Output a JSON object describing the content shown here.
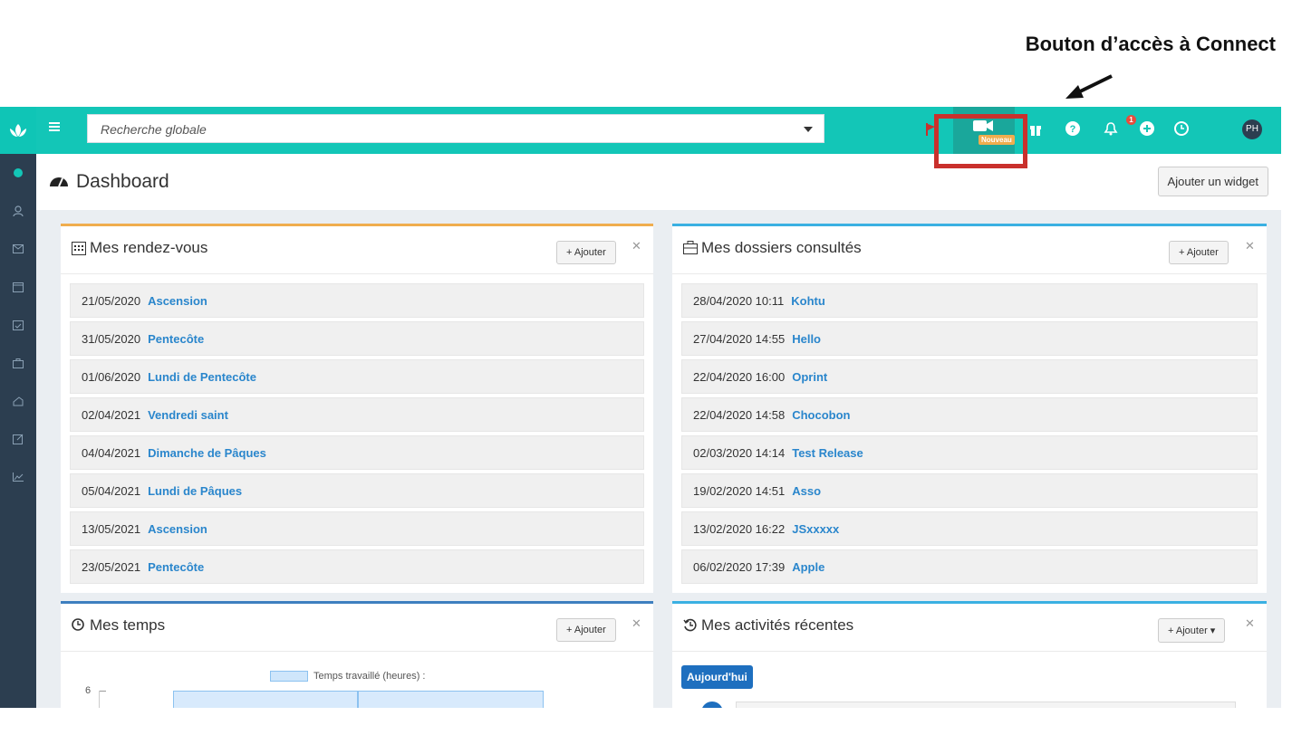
{
  "callout": {
    "text": "Bouton d’accès à Connect"
  },
  "search": {
    "placeholder": "Recherche globale"
  },
  "topbar": {
    "connect_badge": "Nouveau",
    "notifications_count": "1",
    "avatar": "PH",
    "accent": "#13c6b7",
    "sidebar_color": "#2c3e50"
  },
  "header": {
    "title": "Dashboard",
    "add_widget": "Ajouter un widget"
  },
  "widgets": {
    "rdv": {
      "title": "Mes rendez-vous",
      "add": "Ajouter",
      "items": [
        {
          "date": "21/05/2020",
          "label": "Ascension"
        },
        {
          "date": "31/05/2020",
          "label": "Pentecôte"
        },
        {
          "date": "01/06/2020",
          "label": "Lundi de Pentecôte"
        },
        {
          "date": "02/04/2021",
          "label": "Vendredi saint"
        },
        {
          "date": "04/04/2021",
          "label": "Dimanche de Pâques"
        },
        {
          "date": "05/04/2021",
          "label": "Lundi de Pâques"
        },
        {
          "date": "13/05/2021",
          "label": "Ascension"
        },
        {
          "date": "23/05/2021",
          "label": "Pentecôte"
        }
      ]
    },
    "dossiers": {
      "title": "Mes dossiers consultés",
      "add": "Ajouter",
      "items": [
        {
          "date": "28/04/2020 10:11",
          "label": "Kohtu"
        },
        {
          "date": "27/04/2020 14:55",
          "label": "Hello"
        },
        {
          "date": "22/04/2020 16:00",
          "label": "Oprint"
        },
        {
          "date": "22/04/2020 14:58",
          "label": "Chocobon"
        },
        {
          "date": "02/03/2020 14:14",
          "label": "Test Release"
        },
        {
          "date": "19/02/2020 14:51",
          "label": "Asso"
        },
        {
          "date": "13/02/2020 16:22",
          "label": "JSxxxxx"
        },
        {
          "date": "06/02/2020 17:39",
          "label": "Apple"
        }
      ]
    },
    "temps": {
      "title": "Mes temps",
      "add": "Ajouter",
      "legend": "Temps travaillé (heures) :",
      "axis_top": "6"
    },
    "activites": {
      "title": "Mes activités récentes",
      "add": "Ajouter",
      "today": "Aujourd'hui"
    }
  },
  "icons": [
    "logo-icon",
    "menu-icon",
    "dashboard-icon",
    "contacts-icon",
    "mail-icon",
    "calendar-icon",
    "tasks-icon",
    "briefcase-icon",
    "invoice-icon",
    "edit-icon",
    "stats-icon",
    "flag-icon",
    "video-camera-icon",
    "gift-icon",
    "help-icon",
    "bell-icon",
    "plus-circle-icon",
    "clock-icon"
  ]
}
